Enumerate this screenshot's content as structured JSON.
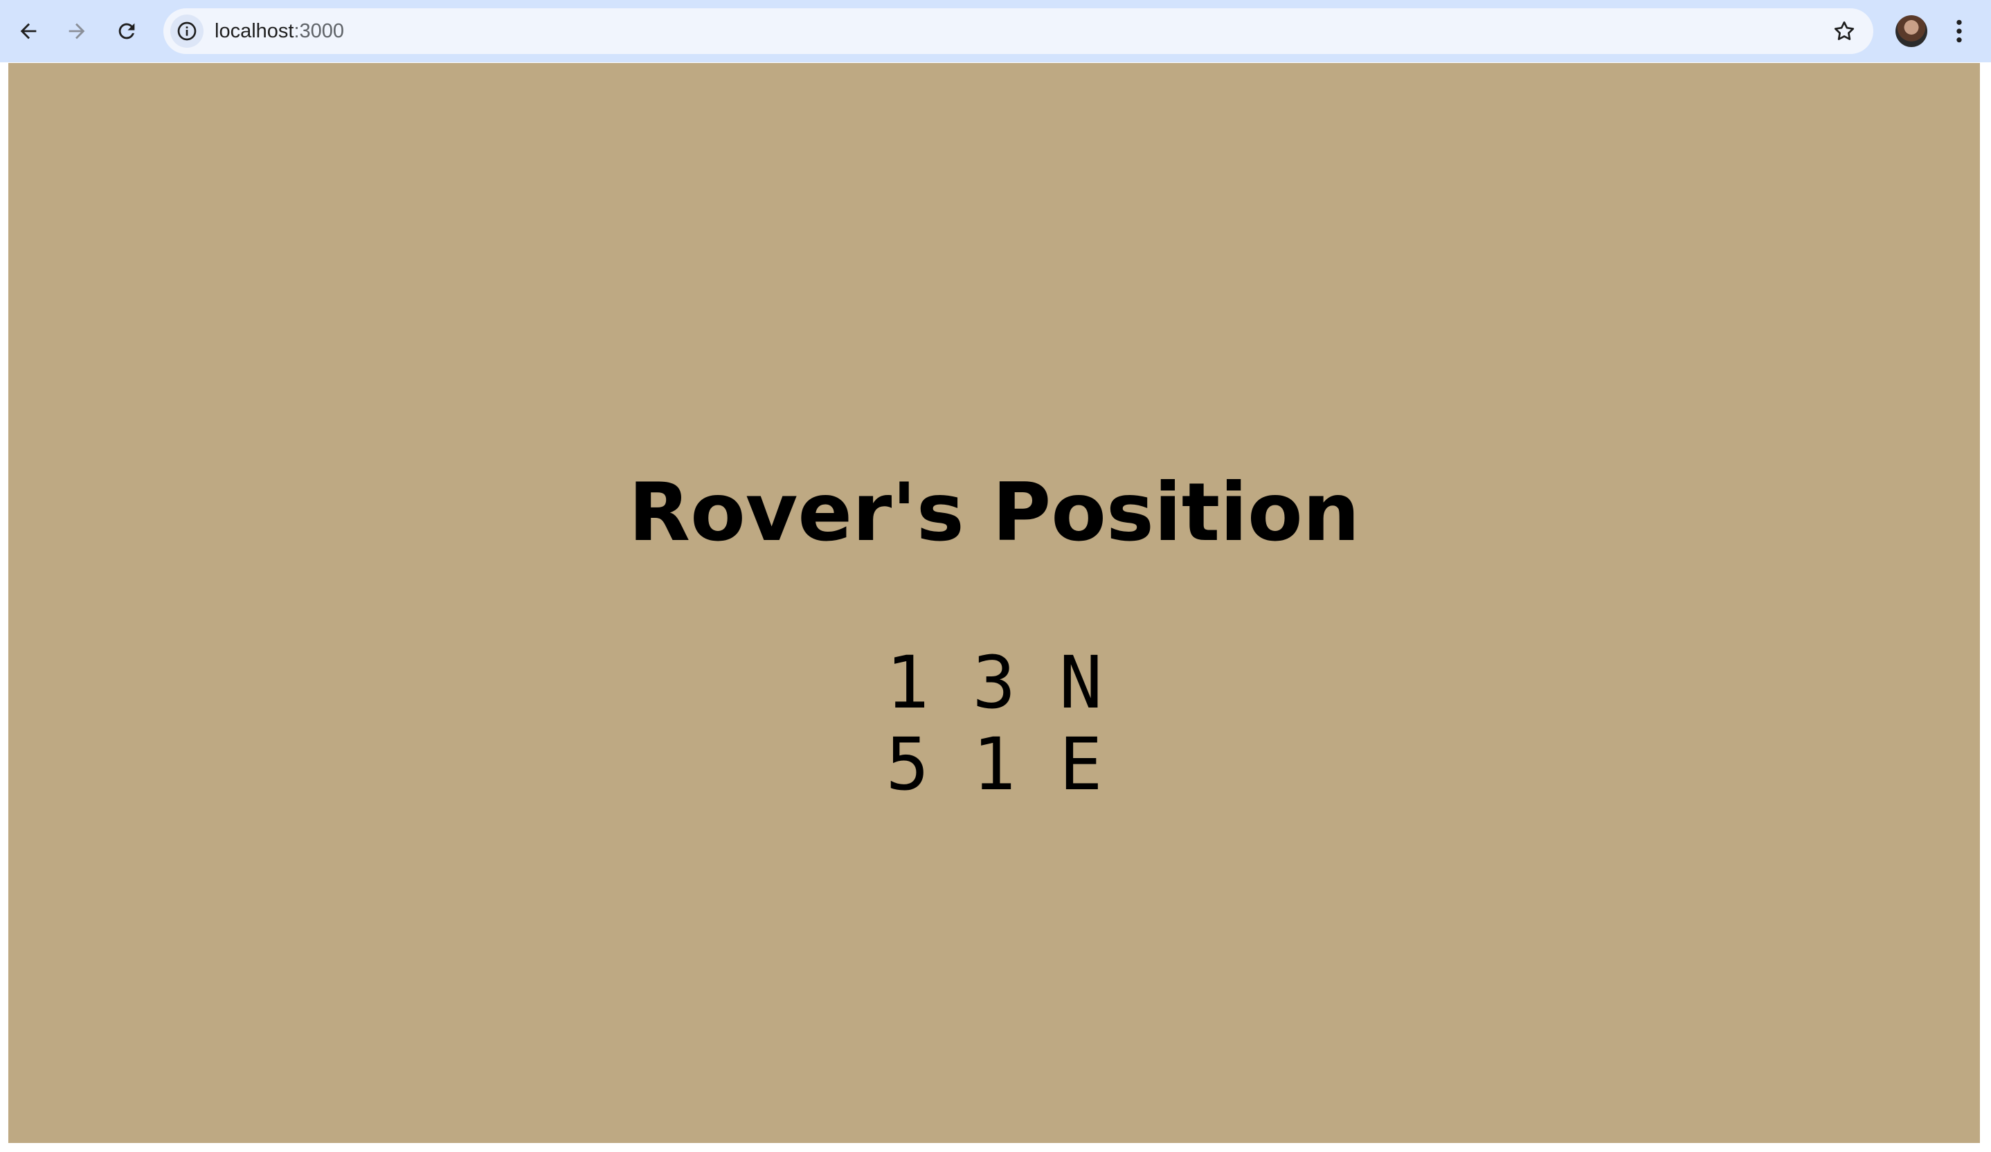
{
  "browser": {
    "url_host": "localhost",
    "url_port": ":3000",
    "icons": {
      "back": "back-arrow-icon",
      "forward": "forward-arrow-icon",
      "reload": "reload-icon",
      "site_info": "info-icon",
      "bookmark": "star-icon",
      "menu": "kebab-menu-icon"
    }
  },
  "page": {
    "title": "Rover's Position",
    "background_color": "#bea983",
    "positions": [
      "1 3 N",
      "5 1 E"
    ]
  }
}
